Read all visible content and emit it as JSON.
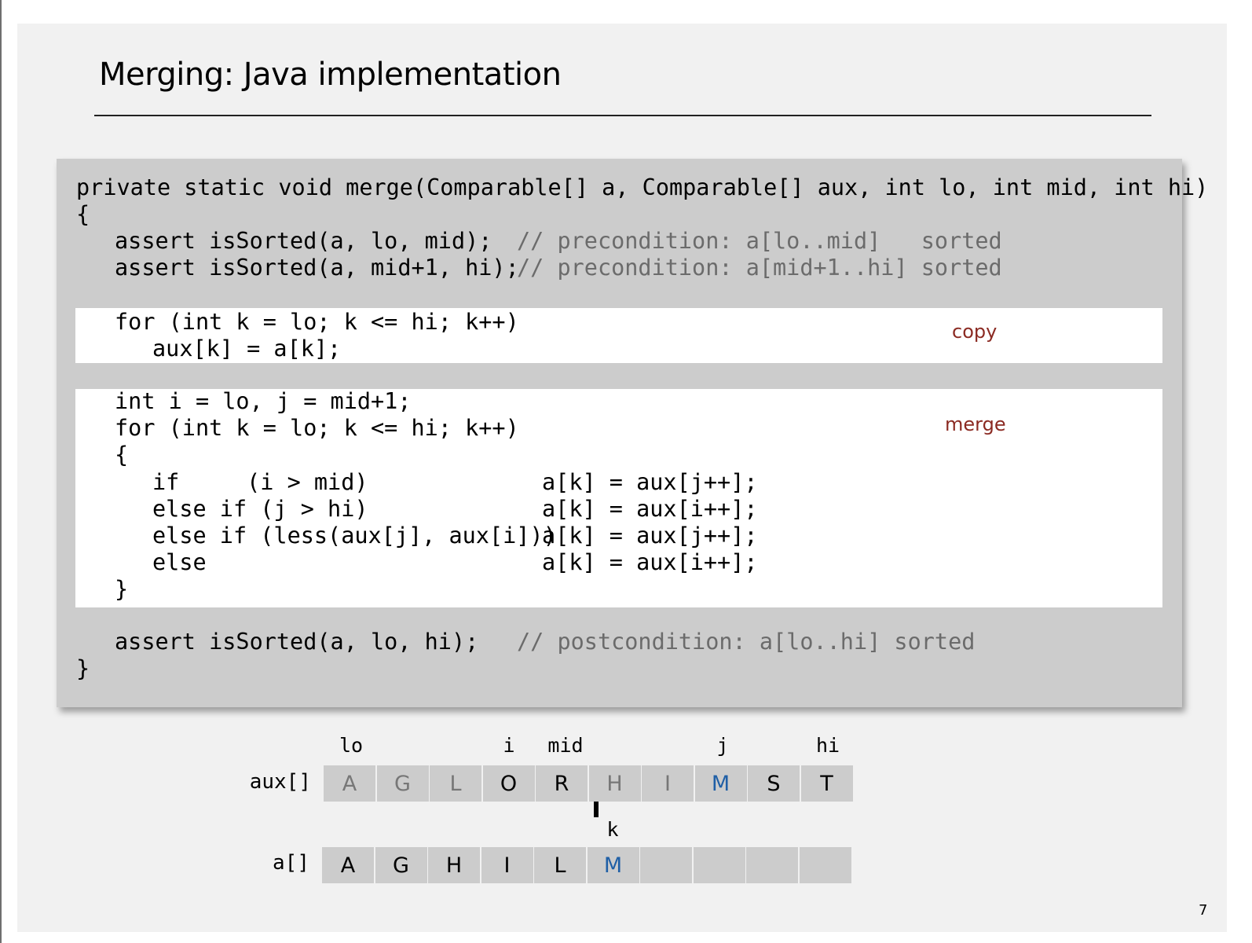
{
  "title": "Merging:  Java implementation",
  "code": {
    "signature": "private static void merge(Comparable[] a, Comparable[] aux, int lo, int mid, int hi)",
    "open_brace": "{",
    "assert1": "assert isSorted(a, lo, mid);",
    "assert1_comment": "// precondition: a[lo..mid]   sorted",
    "assert2": "assert isSorted(a, mid+1, hi);",
    "assert2_comment": "// precondition: a[mid+1..hi] sorted",
    "copy_loop": "for (int k = lo; k <= hi; k++)",
    "copy_body": "aux[k] = a[k];",
    "init_ij": "int i = lo, j = mid+1;",
    "merge_loop": "for (int k = lo; k <= hi; k++)",
    "loop_open": "{",
    "if1_cond": "if     (i > mid)",
    "if1_stmt": "a[k] = aux[j++];",
    "if2_cond": "else if (j > hi)",
    "if2_stmt": "a[k] = aux[i++];",
    "if3_cond": "else if (less(aux[j], aux[i]))",
    "if3_stmt": "a[k] = aux[j++];",
    "if4_cond": "else",
    "if4_stmt": "a[k] = aux[i++];",
    "loop_close": "}",
    "assert3": "assert isSorted(a, lo, hi);",
    "assert3_comment": "// postcondition: a[lo..hi] sorted",
    "close_brace": "}"
  },
  "labels": {
    "copy": "copy",
    "merge": "merge"
  },
  "aux": {
    "label": "aux[]",
    "pointers": {
      "lo": "lo",
      "i": "i",
      "mid": "mid",
      "j": "j",
      "hi": "hi"
    },
    "cells": [
      "A",
      "G",
      "L",
      "O",
      "R",
      "H",
      "I",
      "M",
      "S",
      "T"
    ],
    "cell_colors": [
      "#777777",
      "#777777",
      "#777777",
      "#000000",
      "#000000",
      "#777777",
      "#777777",
      "#1f5fa6",
      "#000000",
      "#000000"
    ]
  },
  "a": {
    "label": "a[]",
    "pointer_k": "k",
    "cells": [
      "A",
      "G",
      "H",
      "I",
      "L",
      "M",
      "",
      "",
      "",
      ""
    ],
    "cell_colors": [
      "#000000",
      "#000000",
      "#000000",
      "#000000",
      "#000000",
      "#1f5fa6",
      "#000000",
      "#000000",
      "#000000",
      "#000000"
    ]
  },
  "page_number": "7"
}
